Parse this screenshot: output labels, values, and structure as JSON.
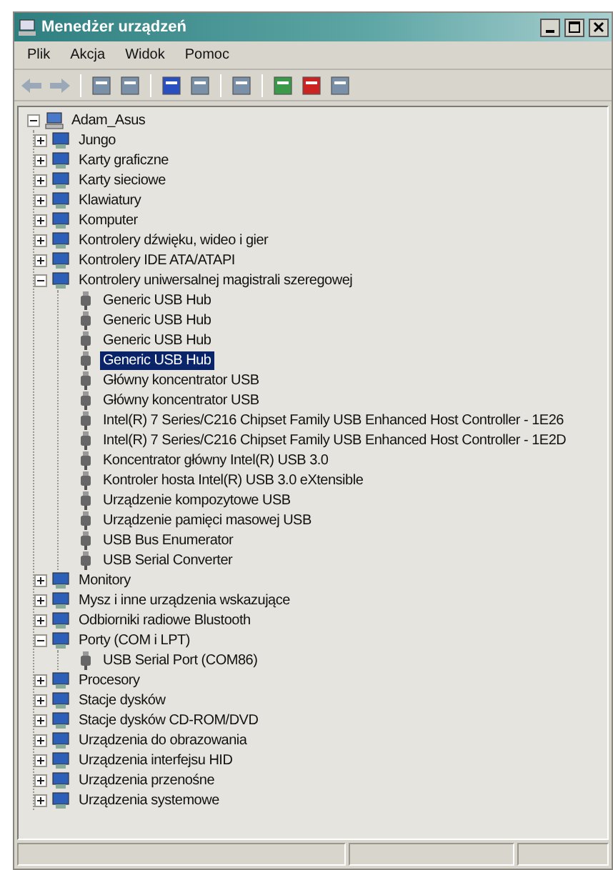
{
  "window": {
    "title": "Menedżer urządzeń"
  },
  "menu": [
    "Plik",
    "Akcja",
    "Widok",
    "Pomoc"
  ],
  "tree": [
    {
      "label": "Adam_Asus",
      "expanded": true,
      "selected": false,
      "children": [
        {
          "label": "Jungo",
          "expanded": false,
          "selected": false
        },
        {
          "label": "Karty graficzne",
          "expanded": false,
          "selected": false
        },
        {
          "label": "Karty sieciowe",
          "expanded": false,
          "selected": false
        },
        {
          "label": "Klawiatury",
          "expanded": false,
          "selected": false
        },
        {
          "label": "Komputer",
          "expanded": false,
          "selected": false
        },
        {
          "label": "Kontrolery dźwięku, wideo i gier",
          "expanded": false,
          "selected": false
        },
        {
          "label": "Kontrolery IDE ATA/ATAPI",
          "expanded": false,
          "selected": false
        },
        {
          "label": "Kontrolery uniwersalnej magistrali szeregowej",
          "expanded": true,
          "selected": false,
          "children": [
            {
              "label": "Generic USB Hub",
              "selected": false
            },
            {
              "label": "Generic USB Hub",
              "selected": false
            },
            {
              "label": "Generic USB Hub",
              "selected": false
            },
            {
              "label": "Generic USB Hub",
              "selected": true
            },
            {
              "label": "Główny koncentrator USB",
              "selected": false
            },
            {
              "label": "Główny koncentrator USB",
              "selected": false
            },
            {
              "label": "Intel(R) 7 Series/C216 Chipset Family USB Enhanced Host Controller - 1E26",
              "selected": false
            },
            {
              "label": "Intel(R) 7 Series/C216 Chipset Family USB Enhanced Host Controller - 1E2D",
              "selected": false
            },
            {
              "label": "Koncentrator główny Intel(R) USB 3.0",
              "selected": false
            },
            {
              "label": "Kontroler hosta Intel(R) USB 3.0 eXtensible",
              "selected": false
            },
            {
              "label": "Urządzenie kompozytowe USB",
              "selected": false
            },
            {
              "label": "Urządzenie pamięci masowej USB",
              "selected": false
            },
            {
              "label": "USB Bus Enumerator",
              "selected": false
            },
            {
              "label": "USB Serial Converter",
              "selected": false
            }
          ]
        },
        {
          "label": "Monitory",
          "expanded": false,
          "selected": false
        },
        {
          "label": "Mysz i inne urządzenia wskazujące",
          "expanded": false,
          "selected": false
        },
        {
          "label": "Odbiorniki radiowe Blustooth",
          "expanded": false,
          "selected": false
        },
        {
          "label": "Porty (COM i LPT)",
          "expanded": true,
          "selected": false,
          "children": [
            {
              "label": "USB Serial Port (COM86)",
              "selected": false
            }
          ]
        },
        {
          "label": "Procesory",
          "expanded": false,
          "selected": false
        },
        {
          "label": "Stacje dysków",
          "expanded": false,
          "selected": false
        },
        {
          "label": "Stacje dysków CD-ROM/DVD",
          "expanded": false,
          "selected": false
        },
        {
          "label": "Urządzenia do obrazowania",
          "expanded": false,
          "selected": false
        },
        {
          "label": "Urządzenia interfejsu HID",
          "expanded": false,
          "selected": false
        },
        {
          "label": "Urządzenia przenośne",
          "expanded": false,
          "selected": false
        },
        {
          "label": "Urządzenia systemowe",
          "expanded": false,
          "selected": false
        }
      ]
    }
  ]
}
